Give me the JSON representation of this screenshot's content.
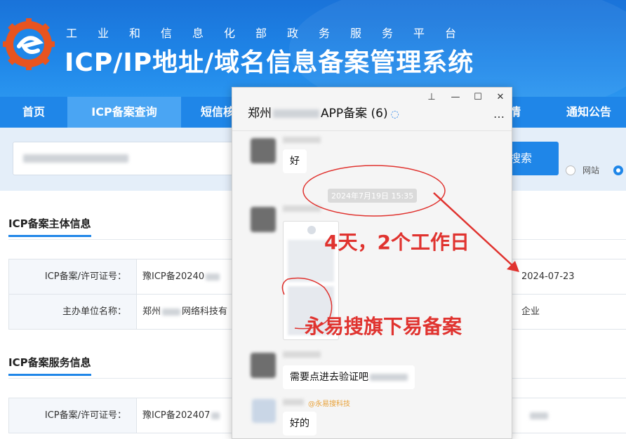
{
  "header": {
    "subtitle": "工业和信息化部政务服务平台",
    "title": "ICP/IP地址/域名信息备案管理系统",
    "brand_color": "#1f86e8"
  },
  "nav": {
    "items": [
      {
        "label": "首页"
      },
      {
        "label": "ICP备案查询"
      },
      {
        "label": "短信核"
      },
      {
        "label": "情"
      },
      {
        "label": "通知公告"
      }
    ]
  },
  "search": {
    "button_label": "搜索",
    "radio_site": "网站"
  },
  "main_section": {
    "title": "ICP备案主体信息",
    "rows": [
      {
        "label": "ICP备案/许可证号：",
        "value": "豫ICP备20240",
        "right": "2024-07-23"
      },
      {
        "label": "主办单位名称：",
        "value_prefix": "郑州",
        "value_suffix": "网络科技有",
        "right": "企业"
      }
    ]
  },
  "service_section": {
    "title": "ICP备案服务信息",
    "rows": [
      {
        "label": "ICP备案/许可证号：",
        "value": "豫ICP备202407"
      }
    ]
  },
  "chat": {
    "title_prefix": "郑州",
    "title_suffix": "APP备案 (6)",
    "win_pin": "⊥",
    "win_min": "—",
    "win_max": "☐",
    "win_close": "✕",
    "more": "…",
    "timestamp": "2024年7月19日 15:35",
    "messages": [
      {
        "text": "好"
      },
      {
        "text": "需要点进去验证吧"
      },
      {
        "tag": "@永易搜科技",
        "text": "好的"
      }
    ]
  },
  "annotations": {
    "duration": "4天，2个工作日",
    "brand": "永易搜旗下易备案",
    "color": "#e0332f"
  }
}
